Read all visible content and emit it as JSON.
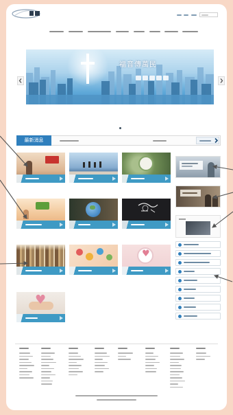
{
  "colors": {
    "page_bg": "#f8d8c6",
    "panel": "#ffffff",
    "accent": "#2f7fbd",
    "caption": "#3f9ac4",
    "arrow": "#555555"
  },
  "banner": {
    "headline": "福音傳萬民"
  },
  "news": {
    "tab_label": "最新消息"
  },
  "icons": {
    "banner_prev": "chevron-left-icon",
    "banner_next": "chevron-right-icon",
    "news_more": "chevron-right-icon",
    "link_bullet": "circle-icon",
    "annotation": "arrow-icon"
  }
}
